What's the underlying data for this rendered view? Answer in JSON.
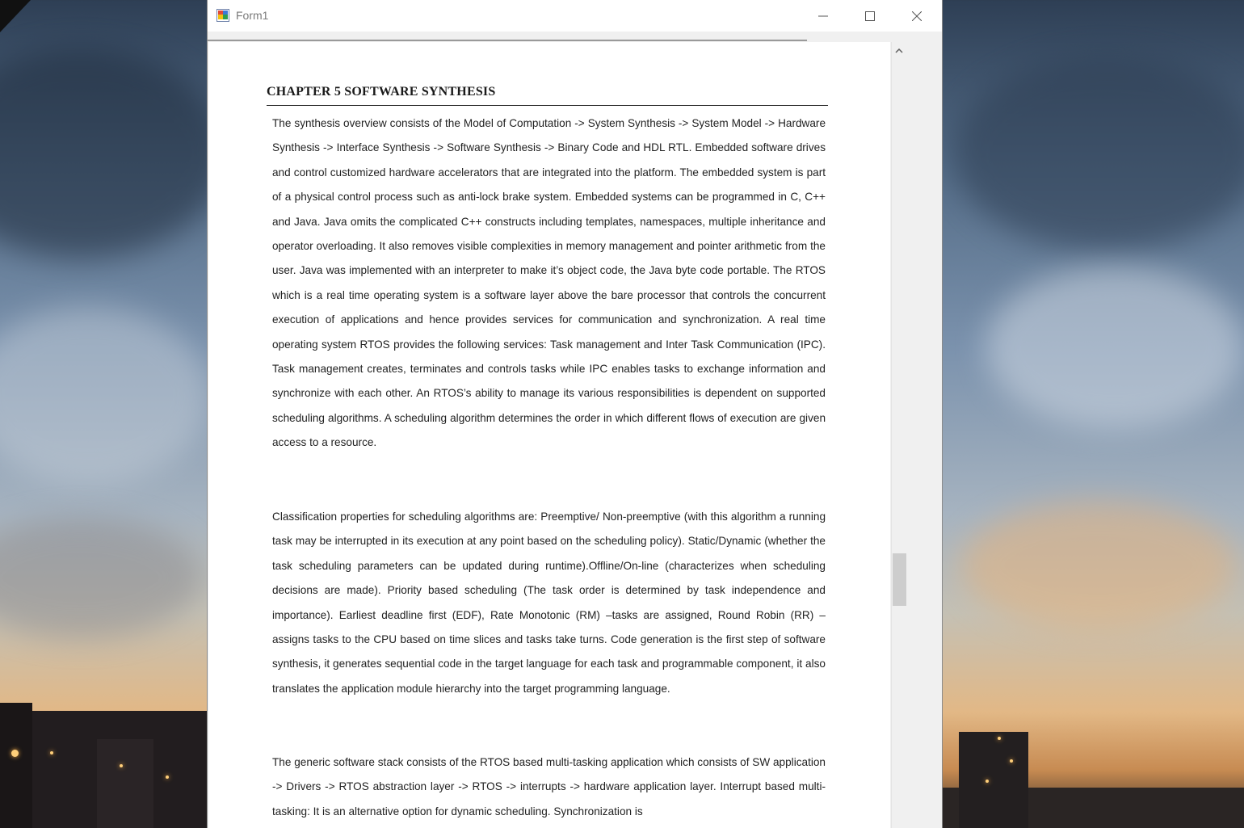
{
  "window": {
    "title": "Form1",
    "minimize_icon": "minimize-icon",
    "maximize_icon": "maximize-icon",
    "close_icon": "close-icon"
  },
  "document": {
    "chapter_title": "CHAPTER 5 SOFTWARE SYNTHESIS",
    "paragraphs": [
      "The synthesis overview consists of the Model of Computation -> System Synthesis -> System Model -> Hardware Synthesis -> Interface Synthesis -> Software Synthesis -> Binary Code and HDL RTL. Embedded software drives and control customized hardware accelerators that are integrated into the platform.  The embedded system is part of a physical control process such as anti-lock brake system. Embedded systems can be programmed in C, C++ and Java.  Java omits the complicated C++ constructs including templates, namespaces, multiple inheritance and operator overloading. It also removes visible complexities in memory management and pointer arithmetic from the user.  Java was implemented with an interpreter to make it’s object code, the Java byte code portable.  The RTOS which is a real time operating system is a software layer above the bare processor that controls the concurrent execution of applications and hence provides services for communication and synchronization.  A real time operating system  RTOS provides the following services:  Task management and Inter Task Communication (IPC). Task management creates, terminates and controls tasks while IPC enables tasks to exchange information and synchronize with each other.  An RTOS’s ability to manage its various responsibilities is dependent on supported scheduling algorithms.  A scheduling algorithm determines the order in which different flows of execution are given access to a resource.",
      "Classification properties for scheduling algorithms are: Preemptive/ Non-preemptive (with this algorithm a running task may be interrupted in its execution at any point based on the scheduling policy). Static/Dynamic (whether the task scheduling parameters can be updated during runtime).Offline/On-line (characterizes when scheduling decisions are made). Priority based scheduling (The task order is determined by task independence and importance). Earliest deadline first (EDF), Rate Monotonic (RM) –tasks are assigned, Round Robin (RR) –  assigns tasks to the CPU based on time slices and tasks take turns.  Code generation is the first step of software synthesis, it generates sequential code in the target language for each task and programmable component, it also translates the application module hierarchy into the target programming language.",
      "The generic software stack consists of the RTOS based multi-tasking application which consists of SW application -> Drivers -> RTOS abstraction layer -> RTOS -> interrupts -> hardware application layer. Interrupt based multi-tasking: It is an alternative option for dynamic scheduling.    Synchronization is"
    ]
  },
  "scrollbar": {
    "up_icon": "chevron-up-icon",
    "position_fraction": 0.7
  },
  "colors": {
    "window_bg": "#ffffff",
    "client_bg": "#f0f0f0",
    "scroll_thumb": "#cdcdcd",
    "title_text": "#7a7a7a"
  }
}
